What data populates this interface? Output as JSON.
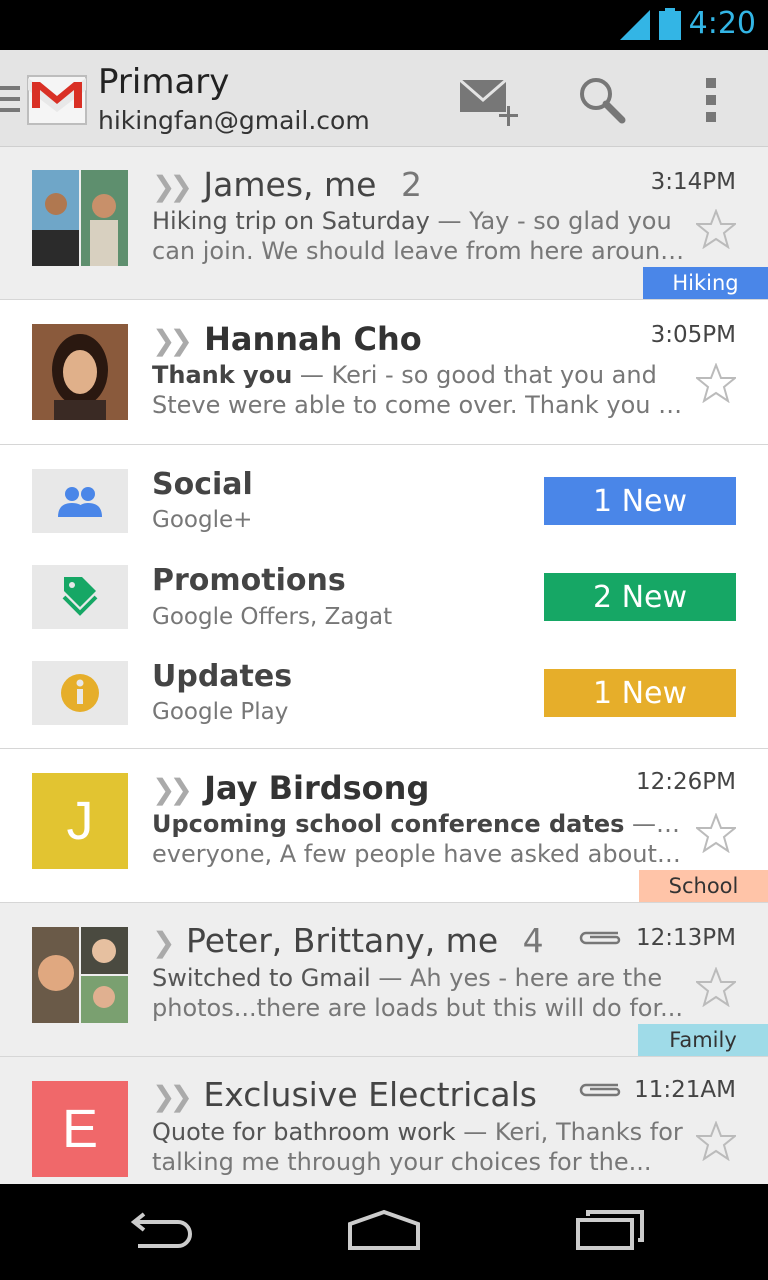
{
  "status_bar": {
    "time": "4:20",
    "icons": [
      "signal-icon",
      "battery-icon"
    ]
  },
  "action_bar": {
    "title": "Primary",
    "account": "hikingfan@gmail.com",
    "icons": [
      "nav-drawer-icon",
      "gmail-logo",
      "compose-icon",
      "search-icon",
      "overflow-menu-icon"
    ]
  },
  "colors": {
    "accent": "#33b5e5",
    "hiking_label": "#4a86e8",
    "school_label": "#ffc4a8",
    "family_label": "#9fdbe8",
    "social": "#4a86e8",
    "promotions": "#16a765",
    "updates": "#e6ae2a"
  },
  "conversations": [
    {
      "sender": "James, me",
      "count": "2",
      "time": "3:14PM",
      "subject": "Hiking trip on Saturday",
      "snippet_line1": " — Yay - so glad you",
      "snippet_line2": "can join. We should leave from here around...",
      "label": "Hiking",
      "unread": false
    },
    {
      "sender": "Hannah Cho",
      "count": "",
      "time": "3:05PM",
      "subject": "Thank you",
      "snippet_line1": " — Keri - so good that you and",
      "snippet_line2": "Steve were able to come over. Thank you so...",
      "label": "",
      "unread": true
    },
    {
      "sender": "Jay Birdsong",
      "count": "",
      "time": "12:26PM",
      "subject": "Upcoming school conference dates",
      "snippet_line1": " — Hello",
      "snippet_line2": "everyone, A few people have asked about th...",
      "label": "School",
      "avatar_letter": "J",
      "unread": true
    },
    {
      "sender": "Peter, Brittany, me",
      "count": "4",
      "time": "12:13PM",
      "subject": "Switched to Gmail",
      "snippet_line1": " — Ah yes - here are the",
      "snippet_line2": "photos...there are loads but this will do for...",
      "label": "Family",
      "unread": false
    },
    {
      "sender": "Exclusive Electricals",
      "count": "",
      "time": "11:21AM",
      "subject": "Quote for bathroom work",
      "snippet_line1": " — Keri, Thanks for",
      "snippet_line2": "talking me through your choices for the...",
      "label": "",
      "avatar_letter": "E",
      "unread": false
    }
  ],
  "categories": [
    {
      "name": "Social",
      "sources": "Google+",
      "badge": "1 New",
      "icon": "social-people-icon"
    },
    {
      "name": "Promotions",
      "sources": "Google Offers, Zagat",
      "badge": "2 New",
      "icon": "promotions-tag-icon"
    },
    {
      "name": "Updates",
      "sources": "Google Play",
      "badge": "1 New",
      "icon": "updates-info-icon"
    }
  ],
  "nav_bar": {
    "icons": [
      "back-icon",
      "home-icon",
      "recents-icon"
    ]
  }
}
